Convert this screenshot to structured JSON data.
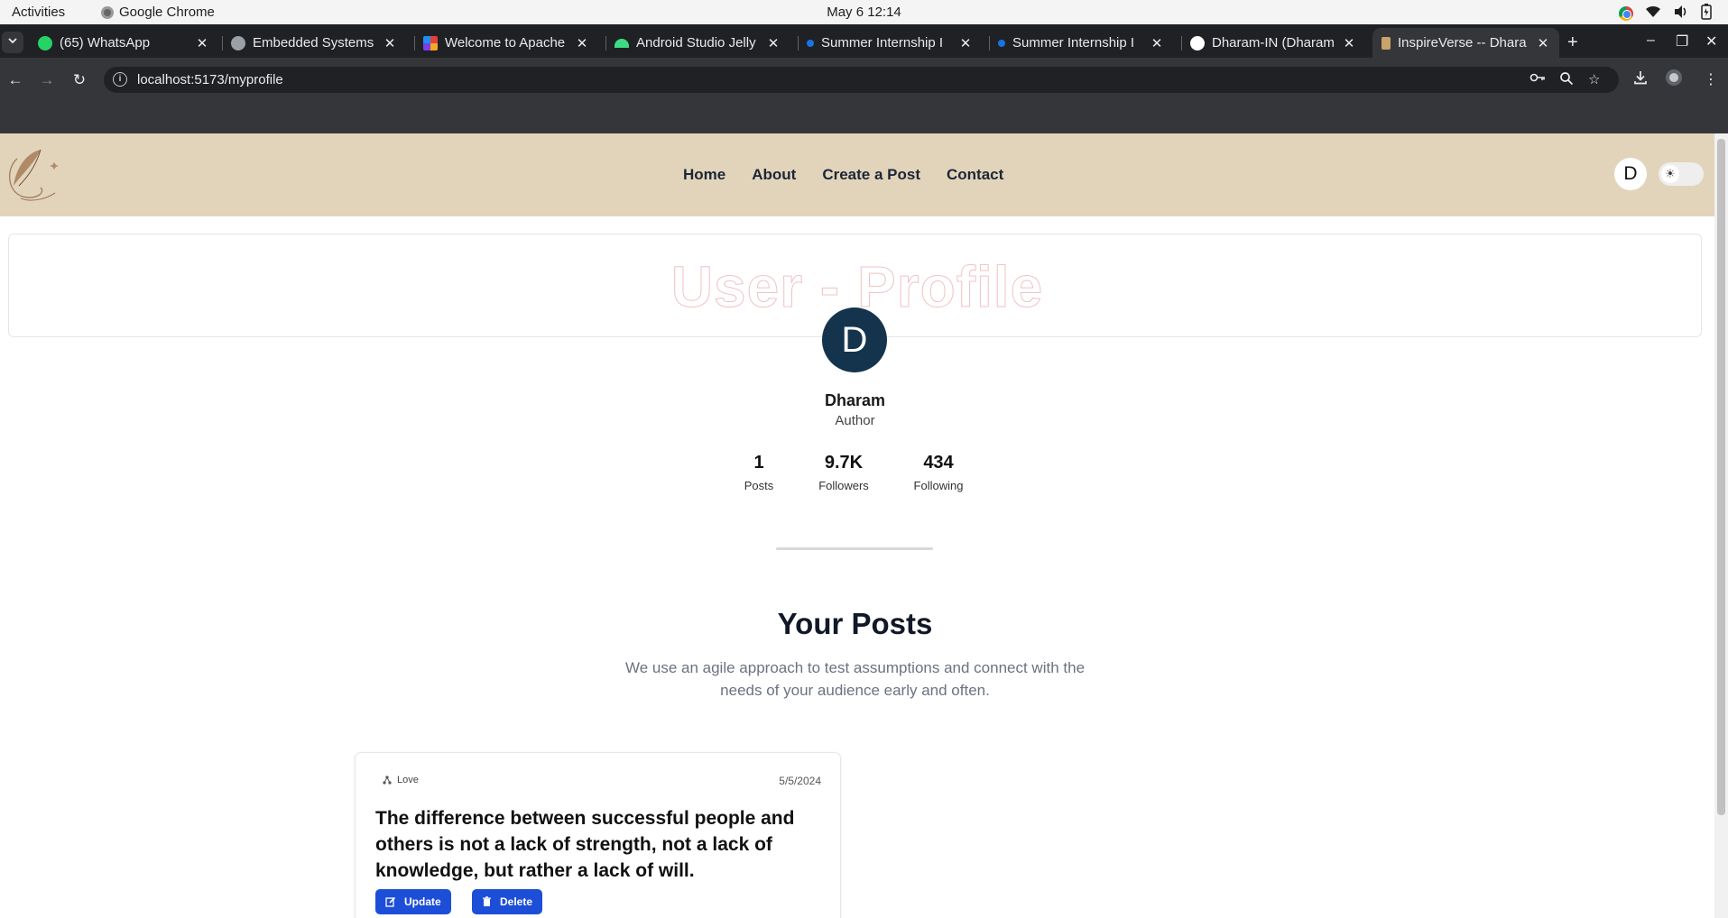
{
  "system": {
    "activities": "Activities",
    "app_name": "Google Chrome",
    "clock": "May 6  12:14"
  },
  "browser": {
    "tabs": [
      {
        "title": "(65) WhatsApp",
        "icon": "whatsapp-icon",
        "color": "#25d366"
      },
      {
        "title": "Embedded Systems I",
        "icon": "globe-icon",
        "color": "#9aa0a6"
      },
      {
        "title": "Welcome to Apache I",
        "icon": "apache-icon",
        "color": "#e0413f"
      },
      {
        "title": "Android Studio Jelly",
        "icon": "android-icon",
        "color": "#3ddc84"
      },
      {
        "title": "Summer Internship I",
        "icon": "internship-icon",
        "color": "#1a73e8"
      },
      {
        "title": "Summer Internship I",
        "icon": "internship-icon",
        "color": "#1a73e8"
      },
      {
        "title": "Dharam-IN (Dharam",
        "icon": "github-icon",
        "color": "#ffffff"
      },
      {
        "title": "InspireVerse -- Dhara",
        "icon": "inspireverse-icon",
        "color": "#c9a36a"
      }
    ],
    "url": "localhost:5173/myprofile"
  },
  "site": {
    "nav": [
      "Home",
      "About",
      "Create a Post",
      "Contact"
    ],
    "avatar_initial": "D"
  },
  "profile": {
    "heading": "User - Profile",
    "avatar_initial": "D",
    "name": "Dharam",
    "role": "Author",
    "stats": [
      {
        "value": "1",
        "label": "Posts"
      },
      {
        "value": "9.7K",
        "label": "Followers"
      },
      {
        "value": "434",
        "label": "Following"
      }
    ]
  },
  "posts_section": {
    "heading": "Your Posts",
    "subtitle": "We use an agile approach to test assumptions and connect with the needs of your audience early and often."
  },
  "post": {
    "category": "Love",
    "date": "5/5/2024",
    "title": "The difference between successful people and others is not a lack of strength, not a lack of knowledge, but rather a lack of will.",
    "update_label": "Update",
    "delete_label": "Delete"
  },
  "colors": {
    "nav_background": "#e2d4bb",
    "avatar_background": "#14344d",
    "button": "#1d4ed8",
    "heading_outline": "#f1c3c3"
  }
}
